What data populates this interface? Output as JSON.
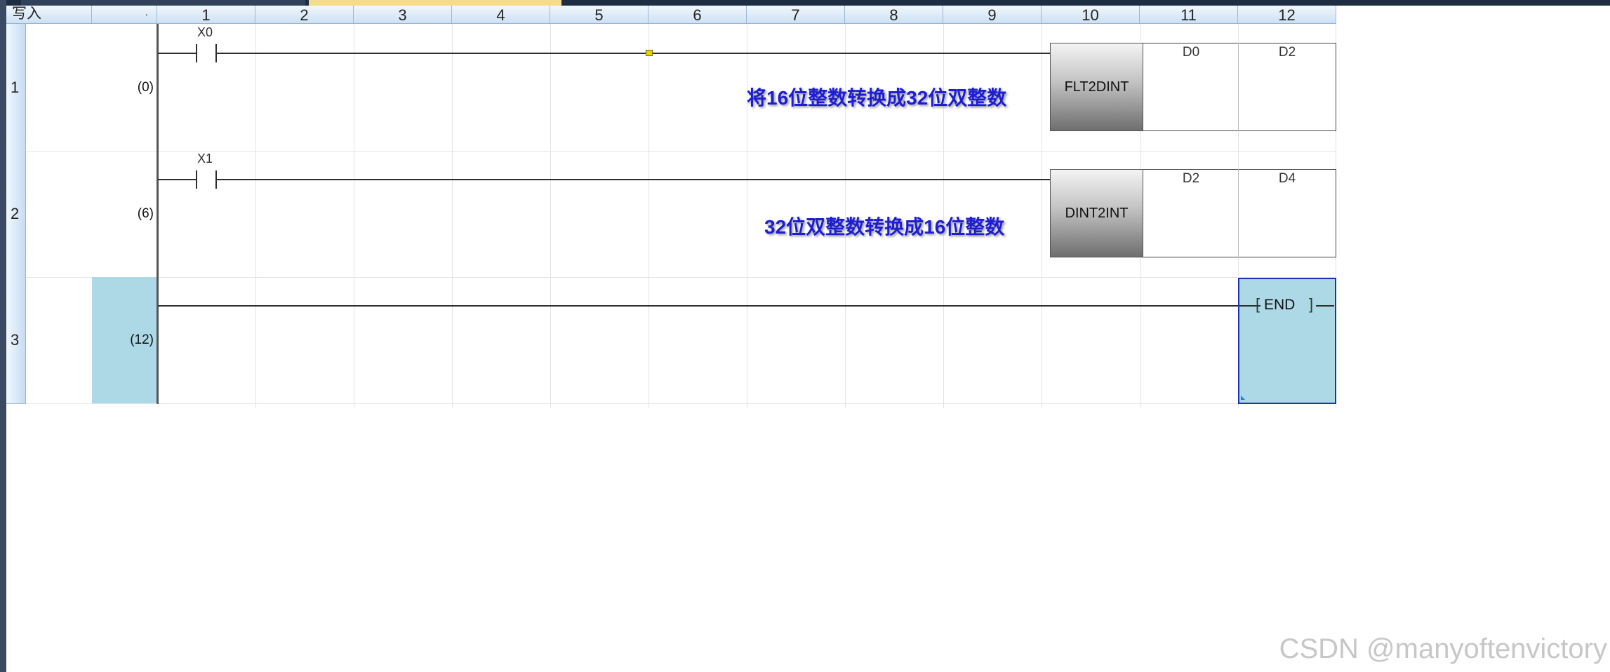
{
  "header": {
    "mode_label": "写入",
    "step_header_mark": "·",
    "columns": [
      "1",
      "2",
      "3",
      "4",
      "5",
      "6",
      "7",
      "8",
      "9",
      "10",
      "11",
      "12"
    ]
  },
  "rows": [
    {
      "number": "1",
      "step": "(0)",
      "contact": "X0",
      "instruction": "FLT2DINT",
      "operand_1": "D0",
      "operand_2": "D2",
      "comment": "将16位整数转换成32位双整数"
    },
    {
      "number": "2",
      "step": "(6)",
      "contact": "X1",
      "instruction": "DINT2INT",
      "operand_1": "D2",
      "operand_2": "D4",
      "comment": "32位双整数转换成16位整数"
    },
    {
      "number": "3",
      "step": "(12)",
      "instruction": "END"
    }
  ],
  "watermark": "CSDN @manyoftenvictory",
  "colors": {
    "selection": "#add8e6",
    "comment_text": "#1d1dd6",
    "header_bg": "#cde1f4"
  }
}
